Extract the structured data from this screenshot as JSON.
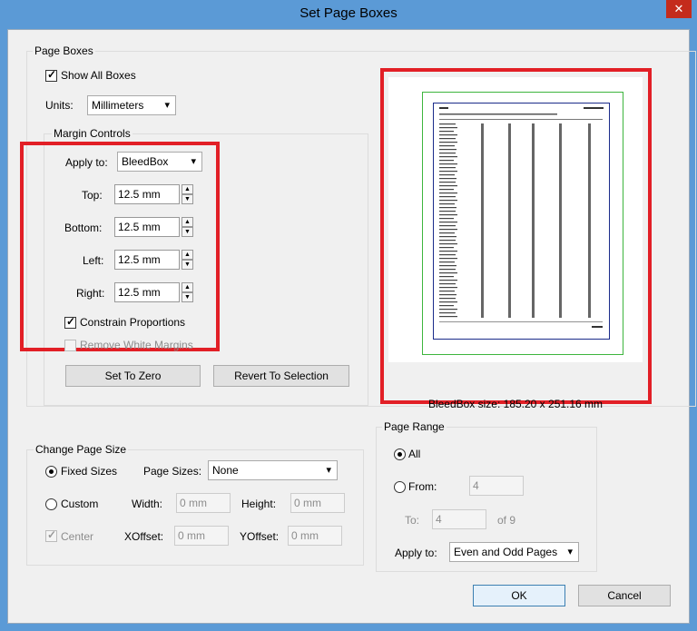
{
  "window": {
    "title": "Set Page Boxes",
    "close_glyph": "✕"
  },
  "page_boxes": {
    "group_title": "Page Boxes",
    "show_all_boxes_label": "Show All Boxes",
    "show_all_boxes_checked": true,
    "units_label": "Units:",
    "units_value": "Millimeters"
  },
  "margin_controls": {
    "group_title": "Margin Controls",
    "apply_to_label": "Apply to:",
    "apply_to_value": "BleedBox",
    "top_label": "Top:",
    "top_value": "12.5 mm",
    "bottom_label": "Bottom:",
    "bottom_value": "12.5 mm",
    "left_label": "Left:",
    "left_value": "12.5 mm",
    "right_label": "Right:",
    "right_value": "12.5 mm",
    "constrain_label": "Constrain Proportions",
    "constrain_checked": true,
    "remove_white_label": "Remove White Margins",
    "set_to_zero_label": "Set To Zero",
    "revert_label": "Revert To Selection"
  },
  "preview": {
    "size_text": "BleedBox size: 185.20 x 251.16 mm"
  },
  "change_page_size": {
    "group_title": "Change Page Size",
    "fixed_sizes_label": "Fixed Sizes",
    "page_sizes_label": "Page Sizes:",
    "page_sizes_value": "None",
    "custom_label": "Custom",
    "width_label": "Width:",
    "width_value": "0 mm",
    "height_label": "Height:",
    "height_value": "0 mm",
    "center_label": "Center",
    "xoffset_label": "XOffset:",
    "xoffset_value": "0 mm",
    "yoffset_label": "YOffset:",
    "yoffset_value": "0 mm"
  },
  "page_range": {
    "group_title": "Page Range",
    "all_label": "All",
    "from_label": "From:",
    "from_value": "4",
    "to_label": "To:",
    "to_value": "4",
    "of_text": "of 9",
    "apply_to_label": "Apply to:",
    "apply_to_value": "Even and Odd Pages"
  },
  "footer": {
    "ok_label": "OK",
    "cancel_label": "Cancel"
  },
  "colors": {
    "highlight": "#e21f26",
    "trim": "#3db53d",
    "media": "#1a2b8a"
  }
}
